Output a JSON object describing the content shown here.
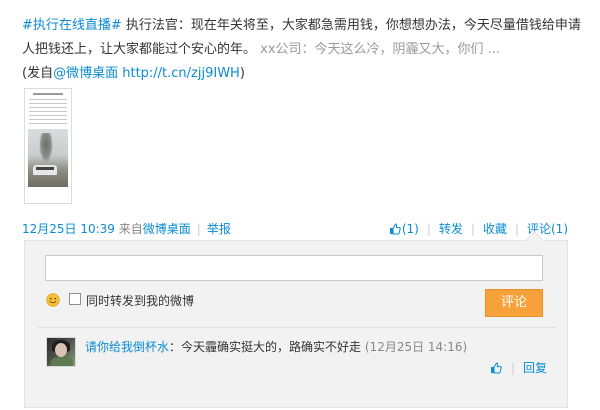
{
  "post": {
    "hashtag": "#执行在线直播#",
    "text": " 执行法官：现在年关将至，大家都急需用钱，你想想办法，今天尽量借钱给申请人把钱还上，让大家都能过个安心的年。",
    "cut_text": "xx公司：今天这么冷，阴霾又大，你们 ...",
    "source_prefix": "(发自",
    "source_name": "@微博桌面",
    "short_link": "http://t.cn/zjj9IWH",
    "source_suffix": ")"
  },
  "meta": {
    "date": "12月25日 10:39",
    "from_prefix": "来自",
    "from_app": "微博桌面",
    "separator": "|",
    "report": "举报"
  },
  "actions": {
    "like_count": "(1)",
    "repost": "转发",
    "favorite": "收藏",
    "comment": "评论(1)",
    "separator": "|"
  },
  "comment_box": {
    "input_value": "",
    "repost_label": "同时转发到我的微博",
    "submit_label": "评论"
  },
  "comments": [
    {
      "user": "请你给我倒杯水",
      "colon": "：",
      "text": "今天霾确实挺大的，路确实不好走",
      "time": "(12月25日 14:16)",
      "reply": "回复",
      "separator": "|"
    }
  ],
  "colors": {
    "link": "#0a8cd2",
    "submit_bg": "#f7a13a",
    "panel_bg": "#f2f2f2"
  },
  "icons": {
    "like": "thumbs-up-icon",
    "emoji": "smiley-icon",
    "comment_like": "thumbs-up-icon"
  }
}
